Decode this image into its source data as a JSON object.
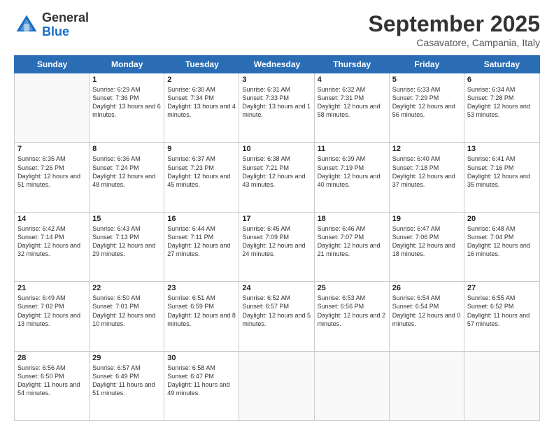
{
  "header": {
    "logo_general": "General",
    "logo_blue": "Blue",
    "month_title": "September 2025",
    "location": "Casavatore, Campania, Italy"
  },
  "days_of_week": [
    "Sunday",
    "Monday",
    "Tuesday",
    "Wednesday",
    "Thursday",
    "Friday",
    "Saturday"
  ],
  "weeks": [
    [
      {
        "day": "",
        "sunrise": "",
        "sunset": "",
        "daylight": ""
      },
      {
        "day": "1",
        "sunrise": "Sunrise: 6:29 AM",
        "sunset": "Sunset: 7:36 PM",
        "daylight": "Daylight: 13 hours and 6 minutes."
      },
      {
        "day": "2",
        "sunrise": "Sunrise: 6:30 AM",
        "sunset": "Sunset: 7:34 PM",
        "daylight": "Daylight: 13 hours and 4 minutes."
      },
      {
        "day": "3",
        "sunrise": "Sunrise: 6:31 AM",
        "sunset": "Sunset: 7:33 PM",
        "daylight": "Daylight: 13 hours and 1 minute."
      },
      {
        "day": "4",
        "sunrise": "Sunrise: 6:32 AM",
        "sunset": "Sunset: 7:31 PM",
        "daylight": "Daylight: 12 hours and 58 minutes."
      },
      {
        "day": "5",
        "sunrise": "Sunrise: 6:33 AM",
        "sunset": "Sunset: 7:29 PM",
        "daylight": "Daylight: 12 hours and 56 minutes."
      },
      {
        "day": "6",
        "sunrise": "Sunrise: 6:34 AM",
        "sunset": "Sunset: 7:28 PM",
        "daylight": "Daylight: 12 hours and 53 minutes."
      }
    ],
    [
      {
        "day": "7",
        "sunrise": "Sunrise: 6:35 AM",
        "sunset": "Sunset: 7:26 PM",
        "daylight": "Daylight: 12 hours and 51 minutes."
      },
      {
        "day": "8",
        "sunrise": "Sunrise: 6:36 AM",
        "sunset": "Sunset: 7:24 PM",
        "daylight": "Daylight: 12 hours and 48 minutes."
      },
      {
        "day": "9",
        "sunrise": "Sunrise: 6:37 AM",
        "sunset": "Sunset: 7:23 PM",
        "daylight": "Daylight: 12 hours and 45 minutes."
      },
      {
        "day": "10",
        "sunrise": "Sunrise: 6:38 AM",
        "sunset": "Sunset: 7:21 PM",
        "daylight": "Daylight: 12 hours and 43 minutes."
      },
      {
        "day": "11",
        "sunrise": "Sunrise: 6:39 AM",
        "sunset": "Sunset: 7:19 PM",
        "daylight": "Daylight: 12 hours and 40 minutes."
      },
      {
        "day": "12",
        "sunrise": "Sunrise: 6:40 AM",
        "sunset": "Sunset: 7:18 PM",
        "daylight": "Daylight: 12 hours and 37 minutes."
      },
      {
        "day": "13",
        "sunrise": "Sunrise: 6:41 AM",
        "sunset": "Sunset: 7:16 PM",
        "daylight": "Daylight: 12 hours and 35 minutes."
      }
    ],
    [
      {
        "day": "14",
        "sunrise": "Sunrise: 6:42 AM",
        "sunset": "Sunset: 7:14 PM",
        "daylight": "Daylight: 12 hours and 32 minutes."
      },
      {
        "day": "15",
        "sunrise": "Sunrise: 6:43 AM",
        "sunset": "Sunset: 7:13 PM",
        "daylight": "Daylight: 12 hours and 29 minutes."
      },
      {
        "day": "16",
        "sunrise": "Sunrise: 6:44 AM",
        "sunset": "Sunset: 7:11 PM",
        "daylight": "Daylight: 12 hours and 27 minutes."
      },
      {
        "day": "17",
        "sunrise": "Sunrise: 6:45 AM",
        "sunset": "Sunset: 7:09 PM",
        "daylight": "Daylight: 12 hours and 24 minutes."
      },
      {
        "day": "18",
        "sunrise": "Sunrise: 6:46 AM",
        "sunset": "Sunset: 7:07 PM",
        "daylight": "Daylight: 12 hours and 21 minutes."
      },
      {
        "day": "19",
        "sunrise": "Sunrise: 6:47 AM",
        "sunset": "Sunset: 7:06 PM",
        "daylight": "Daylight: 12 hours and 18 minutes."
      },
      {
        "day": "20",
        "sunrise": "Sunrise: 6:48 AM",
        "sunset": "Sunset: 7:04 PM",
        "daylight": "Daylight: 12 hours and 16 minutes."
      }
    ],
    [
      {
        "day": "21",
        "sunrise": "Sunrise: 6:49 AM",
        "sunset": "Sunset: 7:02 PM",
        "daylight": "Daylight: 12 hours and 13 minutes."
      },
      {
        "day": "22",
        "sunrise": "Sunrise: 6:50 AM",
        "sunset": "Sunset: 7:01 PM",
        "daylight": "Daylight: 12 hours and 10 minutes."
      },
      {
        "day": "23",
        "sunrise": "Sunrise: 6:51 AM",
        "sunset": "Sunset: 6:59 PM",
        "daylight": "Daylight: 12 hours and 8 minutes."
      },
      {
        "day": "24",
        "sunrise": "Sunrise: 6:52 AM",
        "sunset": "Sunset: 6:57 PM",
        "daylight": "Daylight: 12 hours and 5 minutes."
      },
      {
        "day": "25",
        "sunrise": "Sunrise: 6:53 AM",
        "sunset": "Sunset: 6:56 PM",
        "daylight": "Daylight: 12 hours and 2 minutes."
      },
      {
        "day": "26",
        "sunrise": "Sunrise: 6:54 AM",
        "sunset": "Sunset: 6:54 PM",
        "daylight": "Daylight: 12 hours and 0 minutes."
      },
      {
        "day": "27",
        "sunrise": "Sunrise: 6:55 AM",
        "sunset": "Sunset: 6:52 PM",
        "daylight": "Daylight: 11 hours and 57 minutes."
      }
    ],
    [
      {
        "day": "28",
        "sunrise": "Sunrise: 6:56 AM",
        "sunset": "Sunset: 6:50 PM",
        "daylight": "Daylight: 11 hours and 54 minutes."
      },
      {
        "day": "29",
        "sunrise": "Sunrise: 6:57 AM",
        "sunset": "Sunset: 6:49 PM",
        "daylight": "Daylight: 11 hours and 51 minutes."
      },
      {
        "day": "30",
        "sunrise": "Sunrise: 6:58 AM",
        "sunset": "Sunset: 6:47 PM",
        "daylight": "Daylight: 11 hours and 49 minutes."
      },
      {
        "day": "",
        "sunrise": "",
        "sunset": "",
        "daylight": ""
      },
      {
        "day": "",
        "sunrise": "",
        "sunset": "",
        "daylight": ""
      },
      {
        "day": "",
        "sunrise": "",
        "sunset": "",
        "daylight": ""
      },
      {
        "day": "",
        "sunrise": "",
        "sunset": "",
        "daylight": ""
      }
    ]
  ]
}
